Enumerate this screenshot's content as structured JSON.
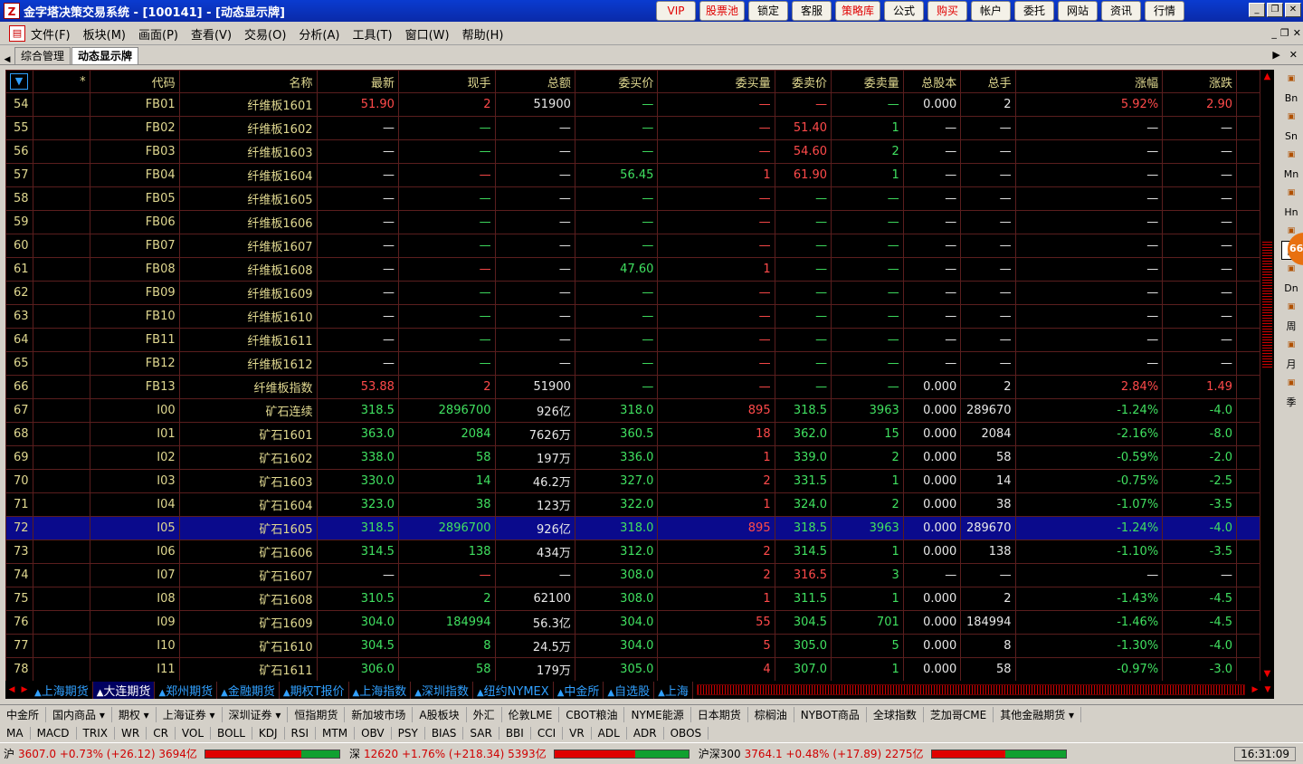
{
  "title": {
    "app_title": "金字塔决策交易系统 - [100141] - [动态显示牌]"
  },
  "top_buttons": [
    {
      "label": "VIP",
      "red": true
    },
    {
      "label": "股票池",
      "red": true
    },
    {
      "label": "锁定",
      "red": false
    },
    {
      "label": "客服",
      "red": false
    },
    {
      "label": "策略库",
      "red": true
    },
    {
      "label": "公式",
      "red": false
    },
    {
      "label": "购买",
      "red": true
    },
    {
      "label": "帐户",
      "red": false
    },
    {
      "label": "委托",
      "red": false
    },
    {
      "label": "网站",
      "red": false
    },
    {
      "label": "资讯",
      "red": false
    },
    {
      "label": "行情",
      "red": false
    }
  ],
  "menu": [
    "文件(F)",
    "板块(M)",
    "画面(P)",
    "查看(V)",
    "交易(O)",
    "分析(A)",
    "工具(T)",
    "窗口(W)",
    "帮助(H)"
  ],
  "tabs": [
    "综合管理",
    "动态显示牌"
  ],
  "table": {
    "headers": [
      "*",
      "代码",
      "名称",
      "最新",
      "现手",
      "总额",
      "委买价",
      "委买量",
      "委卖价",
      "委卖量",
      "总股本",
      "总手",
      "涨幅",
      "涨跌"
    ],
    "selected_row": 18,
    "rows": [
      {
        "n": "54",
        "code": "FB01",
        "name": "纤维板1601",
        "last": "51.90",
        "lc": "up",
        "hand": "2",
        "hc": "up",
        "amt": "51900",
        "bid": "—",
        "bidv": "—",
        "bvc": "up",
        "ask": "—",
        "ac": "up",
        "askv": "—",
        "avc": "dn",
        "cap": "0.000",
        "vol": "2",
        "pct": "5.92%",
        "chg": "2.90",
        "pc": "up"
      },
      {
        "n": "55",
        "code": "FB02",
        "name": "纤维板1602",
        "last": "—",
        "lc": "wh",
        "hand": "—",
        "hc": "dn",
        "amt": "—",
        "bid": "—",
        "bidv": "—",
        "bvc": "up",
        "ask": "51.40",
        "ac": "up",
        "askv": "1",
        "avc": "dn",
        "cap": "—",
        "vol": "—",
        "pct": "—",
        "chg": "—",
        "pc": "wh"
      },
      {
        "n": "56",
        "code": "FB03",
        "name": "纤维板1603",
        "last": "—",
        "lc": "wh",
        "hand": "—",
        "hc": "dn",
        "amt": "—",
        "bid": "—",
        "bidv": "—",
        "bvc": "up",
        "ask": "54.60",
        "ac": "up",
        "askv": "2",
        "avc": "dn",
        "cap": "—",
        "vol": "—",
        "pct": "—",
        "chg": "—",
        "pc": "wh"
      },
      {
        "n": "57",
        "code": "FB04",
        "name": "纤维板1604",
        "last": "—",
        "lc": "wh",
        "hand": "—",
        "hc": "up",
        "amt": "—",
        "bid": "56.45",
        "bidv": "1",
        "bvc": "up",
        "ask": "61.90",
        "ac": "up",
        "askv": "1",
        "avc": "dn",
        "cap": "—",
        "vol": "—",
        "pct": "—",
        "chg": "—",
        "pc": "wh"
      },
      {
        "n": "58",
        "code": "FB05",
        "name": "纤维板1605",
        "last": "—",
        "lc": "wh",
        "hand": "—",
        "hc": "dn",
        "amt": "—",
        "bid": "—",
        "bidv": "—",
        "bvc": "up",
        "ask": "—",
        "ac": "dn",
        "askv": "—",
        "avc": "dn",
        "cap": "—",
        "vol": "—",
        "pct": "—",
        "chg": "—",
        "pc": "wh"
      },
      {
        "n": "59",
        "code": "FB06",
        "name": "纤维板1606",
        "last": "—",
        "lc": "wh",
        "hand": "—",
        "hc": "dn",
        "amt": "—",
        "bid": "—",
        "bidv": "—",
        "bvc": "up",
        "ask": "—",
        "ac": "dn",
        "askv": "—",
        "avc": "dn",
        "cap": "—",
        "vol": "—",
        "pct": "—",
        "chg": "—",
        "pc": "wh"
      },
      {
        "n": "60",
        "code": "FB07",
        "name": "纤维板1607",
        "last": "—",
        "lc": "wh",
        "hand": "—",
        "hc": "dn",
        "amt": "—",
        "bid": "—",
        "bidv": "—",
        "bvc": "up",
        "ask": "—",
        "ac": "dn",
        "askv": "—",
        "avc": "dn",
        "cap": "—",
        "vol": "—",
        "pct": "—",
        "chg": "—",
        "pc": "wh"
      },
      {
        "n": "61",
        "code": "FB08",
        "name": "纤维板1608",
        "last": "—",
        "lc": "wh",
        "hand": "—",
        "hc": "up",
        "amt": "—",
        "bid": "47.60",
        "bidv": "1",
        "bvc": "up",
        "ask": "—",
        "ac": "dn",
        "askv": "—",
        "avc": "dn",
        "cap": "—",
        "vol": "—",
        "pct": "—",
        "chg": "—",
        "pc": "wh"
      },
      {
        "n": "62",
        "code": "FB09",
        "name": "纤维板1609",
        "last": "—",
        "lc": "wh",
        "hand": "—",
        "hc": "dn",
        "amt": "—",
        "bid": "—",
        "bidv": "—",
        "bvc": "up",
        "ask": "—",
        "ac": "dn",
        "askv": "—",
        "avc": "dn",
        "cap": "—",
        "vol": "—",
        "pct": "—",
        "chg": "—",
        "pc": "wh"
      },
      {
        "n": "63",
        "code": "FB10",
        "name": "纤维板1610",
        "last": "—",
        "lc": "wh",
        "hand": "—",
        "hc": "dn",
        "amt": "—",
        "bid": "—",
        "bidv": "—",
        "bvc": "up",
        "ask": "—",
        "ac": "dn",
        "askv": "—",
        "avc": "dn",
        "cap": "—",
        "vol": "—",
        "pct": "—",
        "chg": "—",
        "pc": "wh"
      },
      {
        "n": "64",
        "code": "FB11",
        "name": "纤维板1611",
        "last": "—",
        "lc": "wh",
        "hand": "—",
        "hc": "dn",
        "amt": "—",
        "bid": "—",
        "bidv": "—",
        "bvc": "up",
        "ask": "—",
        "ac": "dn",
        "askv": "—",
        "avc": "dn",
        "cap": "—",
        "vol": "—",
        "pct": "—",
        "chg": "—",
        "pc": "wh"
      },
      {
        "n": "65",
        "code": "FB12",
        "name": "纤维板1612",
        "last": "—",
        "lc": "wh",
        "hand": "—",
        "hc": "dn",
        "amt": "—",
        "bid": "—",
        "bidv": "—",
        "bvc": "up",
        "ask": "—",
        "ac": "dn",
        "askv": "—",
        "avc": "dn",
        "cap": "—",
        "vol": "—",
        "pct": "—",
        "chg": "—",
        "pc": "wh"
      },
      {
        "n": "66",
        "code": "FB13",
        "name": "纤维板指数",
        "last": "53.88",
        "lc": "up",
        "hand": "2",
        "hc": "up",
        "amt": "51900",
        "bid": "—",
        "bidv": "—",
        "bvc": "up",
        "ask": "—",
        "ac": "dn",
        "askv": "—",
        "avc": "dn",
        "cap": "0.000",
        "vol": "2",
        "pct": "2.84%",
        "chg": "1.49",
        "pc": "up"
      },
      {
        "n": "67",
        "code": "I00",
        "name": "矿石连续",
        "last": "318.5",
        "lc": "dn",
        "hand": "2896700",
        "hc": "dn",
        "amt": "926亿",
        "bid": "318.0",
        "bidv": "895",
        "bvc": "up",
        "ask": "318.5",
        "ac": "dn",
        "askv": "3963",
        "avc": "dn",
        "cap": "0.000",
        "vol": "289670",
        "pct": "-1.24%",
        "chg": "-4.0",
        "pc": "dn"
      },
      {
        "n": "68",
        "code": "I01",
        "name": "矿石1601",
        "last": "363.0",
        "lc": "dn",
        "hand": "2084",
        "hc": "dn",
        "amt": "7626万",
        "bid": "360.5",
        "bidv": "18",
        "bvc": "up",
        "ask": "362.0",
        "ac": "dn",
        "askv": "15",
        "avc": "dn",
        "cap": "0.000",
        "vol": "2084",
        "pct": "-2.16%",
        "chg": "-8.0",
        "pc": "dn"
      },
      {
        "n": "69",
        "code": "I02",
        "name": "矿石1602",
        "last": "338.0",
        "lc": "dn",
        "hand": "58",
        "hc": "dn",
        "amt": "197万",
        "bid": "336.0",
        "bidv": "1",
        "bvc": "up",
        "ask": "339.0",
        "ac": "dn",
        "askv": "2",
        "avc": "dn",
        "cap": "0.000",
        "vol": "58",
        "pct": "-0.59%",
        "chg": "-2.0",
        "pc": "dn"
      },
      {
        "n": "70",
        "code": "I03",
        "name": "矿石1603",
        "last": "330.0",
        "lc": "dn",
        "hand": "14",
        "hc": "dn",
        "amt": "46.2万",
        "bid": "327.0",
        "bidv": "2",
        "bvc": "up",
        "ask": "331.5",
        "ac": "dn",
        "askv": "1",
        "avc": "dn",
        "cap": "0.000",
        "vol": "14",
        "pct": "-0.75%",
        "chg": "-2.5",
        "pc": "dn"
      },
      {
        "n": "71",
        "code": "I04",
        "name": "矿石1604",
        "last": "323.0",
        "lc": "dn",
        "hand": "38",
        "hc": "dn",
        "amt": "123万",
        "bid": "322.0",
        "bidv": "1",
        "bvc": "up",
        "ask": "324.0",
        "ac": "dn",
        "askv": "2",
        "avc": "dn",
        "cap": "0.000",
        "vol": "38",
        "pct": "-1.07%",
        "chg": "-3.5",
        "pc": "dn"
      },
      {
        "n": "72",
        "code": "I05",
        "name": "矿石1605",
        "last": "318.5",
        "lc": "dn",
        "hand": "2896700",
        "hc": "dn",
        "amt": "926亿",
        "bid": "318.0",
        "bidv": "895",
        "bvc": "up",
        "ask": "318.5",
        "ac": "dn",
        "askv": "3963",
        "avc": "dn",
        "cap": "0.000",
        "vol": "289670",
        "pct": "-1.24%",
        "chg": "-4.0",
        "pc": "dn"
      },
      {
        "n": "73",
        "code": "I06",
        "name": "矿石1606",
        "last": "314.5",
        "lc": "dn",
        "hand": "138",
        "hc": "dn",
        "amt": "434万",
        "bid": "312.0",
        "bidv": "2",
        "bvc": "up",
        "ask": "314.5",
        "ac": "dn",
        "askv": "1",
        "avc": "dn",
        "cap": "0.000",
        "vol": "138",
        "pct": "-1.10%",
        "chg": "-3.5",
        "pc": "dn"
      },
      {
        "n": "74",
        "code": "I07",
        "name": "矿石1607",
        "last": "—",
        "lc": "wh",
        "hand": "—",
        "hc": "up",
        "amt": "—",
        "bid": "308.0",
        "bidv": "2",
        "bvc": "up",
        "ask": "316.5",
        "ac": "up",
        "askv": "3",
        "avc": "dn",
        "cap": "—",
        "vol": "—",
        "pct": "—",
        "chg": "—",
        "pc": "wh"
      },
      {
        "n": "75",
        "code": "I08",
        "name": "矿石1608",
        "last": "310.5",
        "lc": "dn",
        "hand": "2",
        "hc": "dn",
        "amt": "62100",
        "bid": "308.0",
        "bidv": "1",
        "bvc": "up",
        "ask": "311.5",
        "ac": "dn",
        "askv": "1",
        "avc": "dn",
        "cap": "0.000",
        "vol": "2",
        "pct": "-1.43%",
        "chg": "-4.5",
        "pc": "dn"
      },
      {
        "n": "76",
        "code": "I09",
        "name": "矿石1609",
        "last": "304.0",
        "lc": "dn",
        "hand": "184994",
        "hc": "dn",
        "amt": "56.3亿",
        "bid": "304.0",
        "bidv": "55",
        "bvc": "up",
        "ask": "304.5",
        "ac": "dn",
        "askv": "701",
        "avc": "dn",
        "cap": "0.000",
        "vol": "184994",
        "pct": "-1.46%",
        "chg": "-4.5",
        "pc": "dn"
      },
      {
        "n": "77",
        "code": "I10",
        "name": "矿石1610",
        "last": "304.5",
        "lc": "dn",
        "hand": "8",
        "hc": "dn",
        "amt": "24.5万",
        "bid": "304.0",
        "bidv": "5",
        "bvc": "up",
        "ask": "305.0",
        "ac": "dn",
        "askv": "5",
        "avc": "dn",
        "cap": "0.000",
        "vol": "8",
        "pct": "-1.30%",
        "chg": "-4.0",
        "pc": "dn"
      },
      {
        "n": "78",
        "code": "I11",
        "name": "矿石1611",
        "last": "306.0",
        "lc": "dn",
        "hand": "58",
        "hc": "dn",
        "amt": "179万",
        "bid": "305.0",
        "bidv": "4",
        "bvc": "up",
        "ask": "307.0",
        "ac": "dn",
        "askv": "1",
        "avc": "dn",
        "cap": "0.000",
        "vol": "58",
        "pct": "-0.97%",
        "chg": "-3.0",
        "pc": "dn"
      }
    ]
  },
  "right_toolbar": [
    "Bn",
    "Sn",
    "Mn",
    "Hn",
    "日",
    "Dn",
    "周",
    "月",
    "季"
  ],
  "right_badge": "66",
  "group_tabs": [
    {
      "label": "上海期货",
      "active": false
    },
    {
      "label": "大连期货",
      "active": true
    },
    {
      "label": "郑州期货",
      "active": false
    },
    {
      "label": "金融期货",
      "active": false
    },
    {
      "label": "期权T报价",
      "active": false
    },
    {
      "label": "上海指数",
      "active": false
    },
    {
      "label": "深圳指数",
      "active": false
    },
    {
      "label": "纽约NYMEX",
      "active": false
    },
    {
      "label": "中金所",
      "active": false
    },
    {
      "label": "自选股",
      "active": false
    },
    {
      "label": "上海",
      "active": false
    }
  ],
  "market_tabs": [
    "中金所",
    "国内商品 ▾",
    "期权 ▾",
    "上海证券 ▾",
    "深圳证券 ▾",
    "恒指期货",
    "新加坡市场",
    "A股板块",
    "外汇",
    "伦敦LME",
    "CBOT粮油",
    "NYME能源",
    "日本期货",
    "棕榈油",
    "NYBOT商品",
    "全球指数",
    "芝加哥CME",
    "其他金融期货 ▾"
  ],
  "indicators": [
    "MA",
    "MACD",
    "TRIX",
    "WR",
    "CR",
    "VOL",
    "BOLL",
    "KDJ",
    "RSI",
    "MTM",
    "OBV",
    "PSY",
    "BIAS",
    "SAR",
    "BBI",
    "CCI",
    "VR",
    "ADL",
    "ADR",
    "OBOS"
  ],
  "status": {
    "sh": {
      "label": "沪",
      "value": "3607.0 +0.73% (+26.12) 3694亿"
    },
    "sz": {
      "label": "深",
      "value": "12620 +1.76% (+218.34) 5393亿"
    },
    "hs": {
      "label": "沪深300",
      "value": "3764.1 +0.48% (+17.89) 2275亿"
    },
    "time": "16:31:09"
  }
}
